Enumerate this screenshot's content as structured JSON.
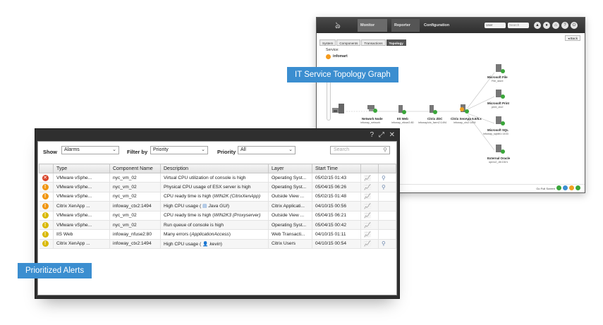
{
  "topology_window": {
    "menu": {
      "monitor": "Monitor",
      "reporter": "Reporter",
      "configuration": "Configuration"
    },
    "user_select": "User",
    "search_placeholder": "Search",
    "tabs": [
      "System",
      "Components",
      "Transactions",
      "Topology"
    ],
    "active_tab": "Topology",
    "back_label": "Back",
    "service_label": "Service:",
    "service_name": "infomart",
    "nodes": [
      {
        "name": "Network Node",
        "sub": "infoway_network"
      },
      {
        "name": "IIS Web",
        "sub": "infoway_nfuse2:80"
      },
      {
        "name": "Citrix ZDC",
        "sub": "infoway/ctx_farm2:1494"
      },
      {
        "name": "Citrix XenApp 6.5/6.x",
        "sub": "infoway_ctx2:1494"
      },
      {
        "name": "Microsoft File",
        "sub": "File_store"
      },
      {
        "name": "Microsoft Print",
        "sub": "print_ctx2"
      },
      {
        "name": "Microsoft SQL",
        "sub": "infoway_sqldb1:1433"
      },
      {
        "name": "External Oracle",
        "sub": "oprcv2_db:1521"
      }
    ],
    "footer_label": "Go Full Screen",
    "colors": {
      "ok": "#3aa63a",
      "warn": "#f0a020",
      "header": "#3a3a3a"
    }
  },
  "alerts_window": {
    "controls": {
      "help": "?",
      "expand": "⤢",
      "close": "✕"
    },
    "filters": {
      "show_label": "Show",
      "show_value": "Alarms",
      "filter_label": "Filter by",
      "filter_value": "Priority",
      "priority_label": "Priority",
      "priority_value": "All",
      "search_placeholder": "Search"
    },
    "columns": [
      "Type",
      "Component Name",
      "Description",
      "Layer",
      "Start Time"
    ],
    "rows": [
      {
        "sev": "critical",
        "type": "VMware vSphe...",
        "component": "nyc_vm_02",
        "desc": "Virtual CPU utilization of console is high",
        "desc_italic": "",
        "desc_end": "",
        "layer": "Operating Syst...",
        "time": "05/02/15 01:43",
        "graph": true,
        "detail": true
      },
      {
        "sev": "major",
        "type": "VMware vSphe...",
        "component": "nyc_vm_02",
        "desc": "Physical CPU usage of ESX server is high",
        "desc_italic": "",
        "desc_end": "",
        "layer": "Operating Syst...",
        "time": "05/04/15 06:26",
        "graph": true,
        "detail": true
      },
      {
        "sev": "major",
        "type": "VMware vSphe...",
        "component": "nyc_vm_02",
        "desc": "CPU ready time is high (",
        "desc_italic": "WIN2K (CitrixXenApp)",
        "desc_end": "",
        "layer": "Outside View ...",
        "time": "05/02/15 01:48",
        "graph": true,
        "detail": false
      },
      {
        "sev": "major",
        "type": "Citrix XenApp ...",
        "component": "infoway_ctx2:1494",
        "desc": "High CPU usage (",
        "desc_icon": "▤",
        "desc_italic": "Java GUI",
        "desc_end": ")",
        "layer": "Citrix Applicati...",
        "time": "04/10/15 00:56",
        "graph": true,
        "detail": false
      },
      {
        "sev": "minor",
        "type": "VMware vSphe...",
        "component": "nyc_vm_02",
        "desc": "CPU ready time is high (",
        "desc_italic": "WIN2K3 (Proxyserver)",
        "desc_end": "",
        "layer": "Outside View ...",
        "time": "05/04/15 06:21",
        "graph": true,
        "detail": false
      },
      {
        "sev": "minor",
        "type": "VMware vSphe...",
        "component": "nyc_vm_02",
        "desc": "Run queue of console is high",
        "desc_italic": "",
        "desc_end": "",
        "layer": "Operating Syst...",
        "time": "05/04/15 00:42",
        "graph": true,
        "detail": false
      },
      {
        "sev": "minor",
        "type": "IIS Web",
        "component": "infoway_nfuse2:80",
        "desc": "Many errors (",
        "desc_italic": "ApplicationAccess",
        "desc_end": ")",
        "layer": "Web Transacti...",
        "time": "04/10/15 01:11",
        "graph": true,
        "detail": false
      },
      {
        "sev": "minor",
        "type": "Citrix XenApp ...",
        "component": "infoway_ctx2:1494",
        "desc": "High CPU usage (",
        "desc_icon": "👤",
        "desc_italic": "kevin",
        "desc_end": ")",
        "layer": "Citrix Users",
        "time": "04/10/15 00:54",
        "graph": true,
        "detail": true
      }
    ],
    "severity_colors": {
      "critical": "#d9452b",
      "major": "#f0950f",
      "minor": "#d8b800"
    },
    "severity_glyphs": {
      "critical": "✕",
      "major": "!",
      "minor": "!"
    }
  },
  "callouts": {
    "topology": "IT Service Topology Graph",
    "alerts": "Prioritized Alerts"
  }
}
